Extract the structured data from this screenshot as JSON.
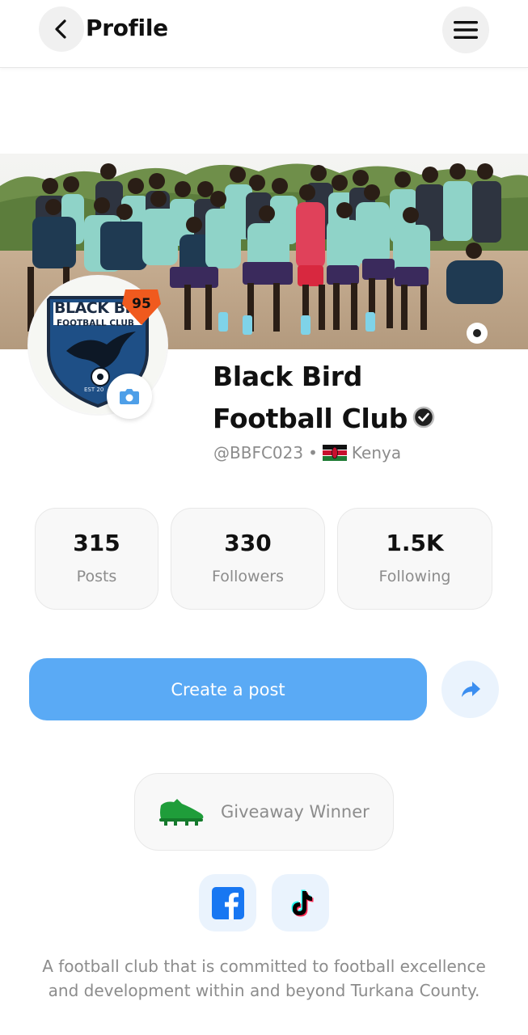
{
  "header": {
    "title": "Profile",
    "back_icon": "chevron-left-icon",
    "menu_icon": "hamburger-menu-icon"
  },
  "cover": {
    "description_icon": "team-photo"
  },
  "avatar": {
    "logo_text_top": "BLACK BI",
    "logo_text_sub": "FOOTBALL CLUB",
    "logo_est": "EST 20",
    "rating": "95"
  },
  "profile": {
    "name_line1": "Black Bird",
    "name_line2": "Football Club",
    "handle": "@BBFC023",
    "separator": "•",
    "country": "Kenya"
  },
  "stats": [
    {
      "value": "315",
      "label": "Posts"
    },
    {
      "value": "330",
      "label": "Followers"
    },
    {
      "value": "1.5K",
      "label": "Following"
    }
  ],
  "actions": {
    "create_post_label": "Create a post",
    "share_icon": "share-arrow-icon"
  },
  "badge": {
    "label": "Giveaway Winner",
    "icon": "football-boot-icon"
  },
  "socials": [
    {
      "name": "facebook",
      "icon": "facebook-icon",
      "color": "#1877f2"
    },
    {
      "name": "tiktok",
      "icon": "tiktok-icon",
      "color": "#000000"
    }
  ],
  "bio": "A football club that is committed to football excellence and development within and beyond Turkana County.",
  "colors": {
    "accent": "#5aaaf5",
    "muted_text": "#8c8c8c",
    "rating_badge": "#f05a1e"
  }
}
